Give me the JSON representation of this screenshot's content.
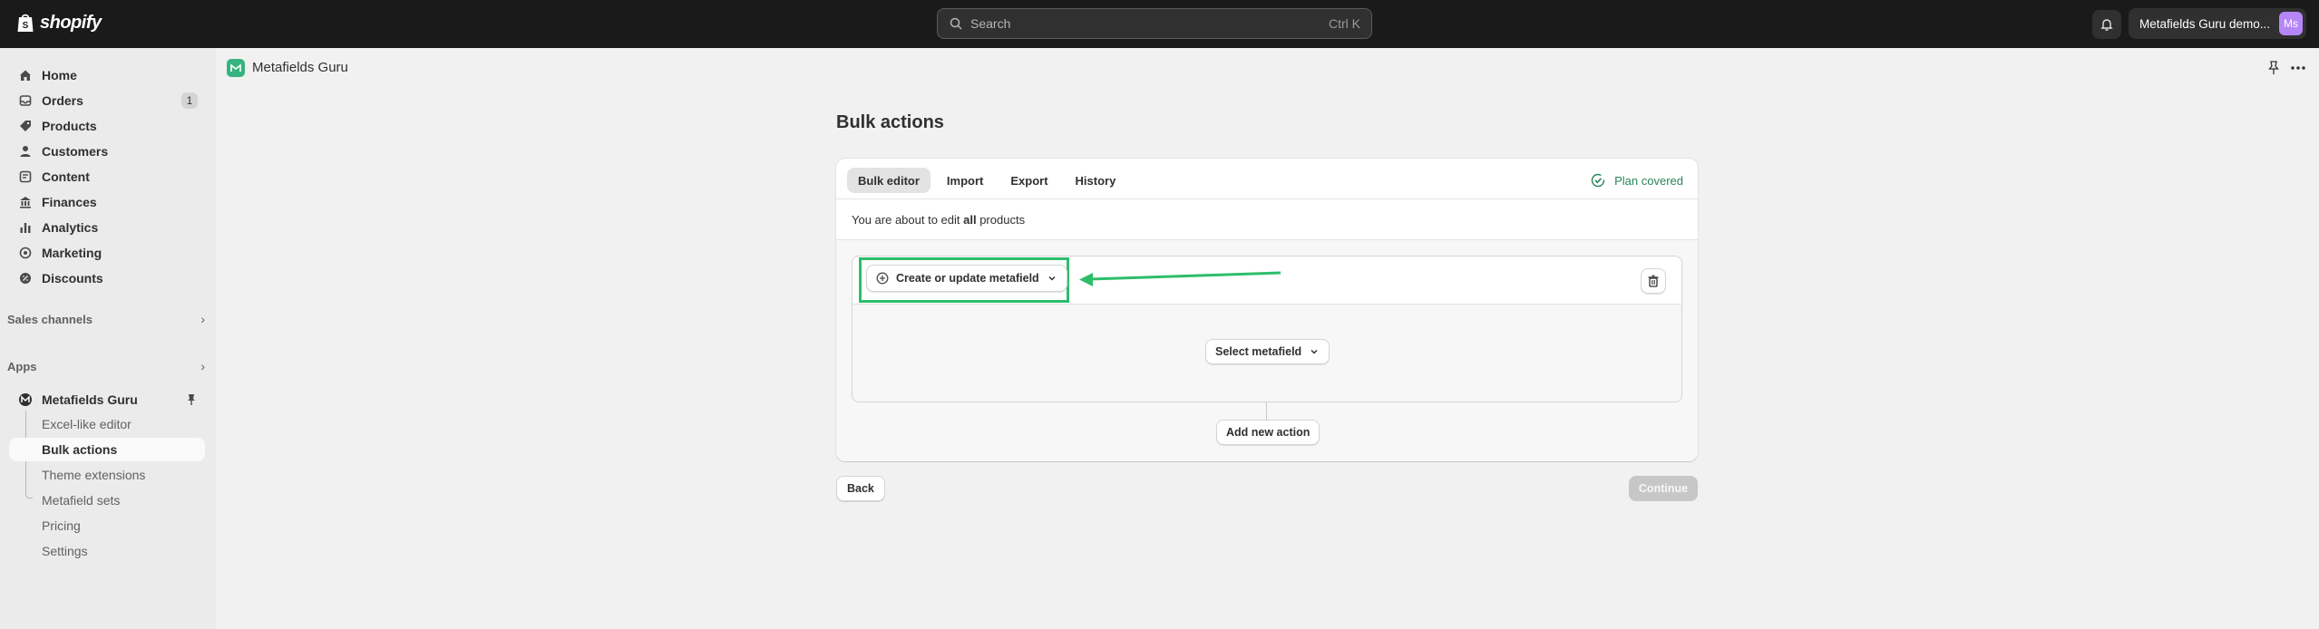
{
  "topbar": {
    "logo_text": "shopify",
    "search_placeholder": "Search",
    "search_shortcut": "Ctrl K",
    "store_name": "Metafields Guru demo...",
    "avatar_initials": "Ms"
  },
  "sidebar": {
    "items": [
      {
        "label": "Home",
        "icon": "home-icon"
      },
      {
        "label": "Orders",
        "icon": "orders-icon",
        "badge": "1"
      },
      {
        "label": "Products",
        "icon": "tag-icon"
      },
      {
        "label": "Customers",
        "icon": "person-icon"
      },
      {
        "label": "Content",
        "icon": "content-icon"
      },
      {
        "label": "Finances",
        "icon": "bank-icon"
      },
      {
        "label": "Analytics",
        "icon": "chart-icon"
      },
      {
        "label": "Marketing",
        "icon": "target-icon"
      },
      {
        "label": "Discounts",
        "icon": "discount-icon"
      }
    ],
    "sales_channels_label": "Sales channels",
    "apps_label": "Apps",
    "app_name": "Metafields Guru",
    "app_subitems": [
      "Excel-like editor",
      "Bulk actions",
      "Theme extensions",
      "Metafield sets",
      "Pricing",
      "Settings"
    ]
  },
  "app_header": {
    "title": "Metafields Guru"
  },
  "main": {
    "page_title": "Bulk actions",
    "tabs": [
      "Bulk editor",
      "Import",
      "Export",
      "History"
    ],
    "active_tab": "Bulk editor",
    "plan_label": "Plan covered",
    "edit_note_prefix": "You are about to edit ",
    "edit_note_bold": "all",
    "edit_note_suffix": " products",
    "create_label": "Create or update metafield",
    "select_label": "Select metafield",
    "add_label": "Add new action",
    "back_label": "Back",
    "continue_label": "Continue"
  },
  "colors": {
    "topbar": "#1a1a1a",
    "highlight": "#2ebd6b",
    "plan_green": "#29845a",
    "avatar": "#b686f7"
  }
}
